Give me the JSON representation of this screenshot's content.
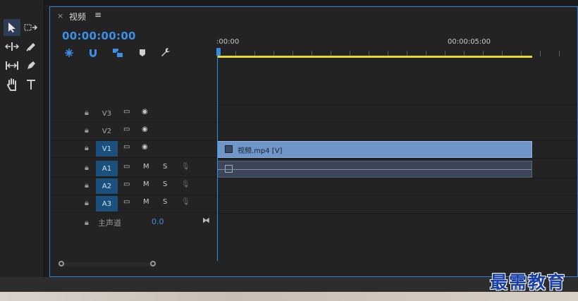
{
  "panel": {
    "close_glyph": "×",
    "title": "视频",
    "menu_glyph": "≡",
    "timecode": "00:00:00:00"
  },
  "ruler": {
    "label_start": ":00:00",
    "label_mid": "00:00:05:00"
  },
  "video_tracks": [
    {
      "name": "V3",
      "selected": false
    },
    {
      "name": "V2",
      "selected": false
    },
    {
      "name": "V1",
      "selected": true
    }
  ],
  "audio_tracks": [
    {
      "name": "A1",
      "m": "M",
      "s": "S"
    },
    {
      "name": "A2",
      "m": "M",
      "s": "S"
    },
    {
      "name": "A3",
      "m": "M",
      "s": "S"
    }
  ],
  "master": {
    "label": "主声道",
    "value": "0.0"
  },
  "clip": {
    "name": "视频.mp4 [V]"
  },
  "watermark": "最需教育",
  "colors": {
    "accent": "#2f8fe8",
    "work_area": "#e6d828",
    "video_clip": "#6f96c9",
    "audio_clip": "#3b4659"
  }
}
